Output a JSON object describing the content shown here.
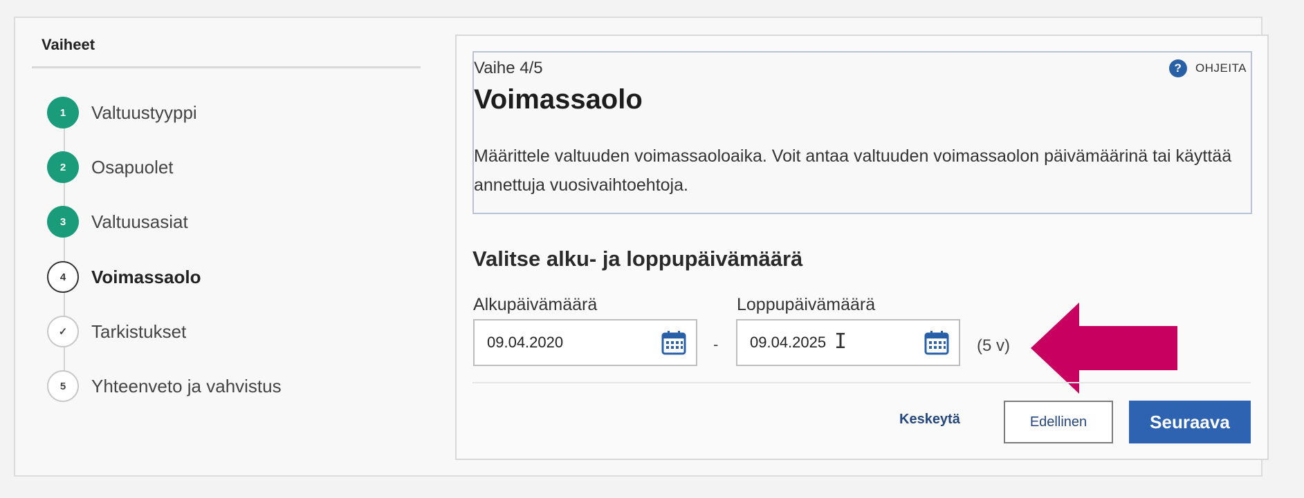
{
  "sidebar": {
    "title": "Vaiheet",
    "steps": [
      {
        "number": "1",
        "label": "Valtuustyyppi",
        "state": "done"
      },
      {
        "number": "2",
        "label": "Osapuolet",
        "state": "done"
      },
      {
        "number": "3",
        "label": "Valtuusasiat",
        "state": "done"
      },
      {
        "number": "4",
        "label": "Voimassaolo",
        "state": "current"
      },
      {
        "number": "✓",
        "label": "Tarkistukset",
        "state": "todo"
      },
      {
        "number": "5",
        "label": "Yhteenveto ja vahvistus",
        "state": "todo"
      }
    ]
  },
  "header": {
    "step_counter": "Vaihe 4/5",
    "help_label": "OHJEITA",
    "help_icon": "?",
    "title": "Voimassaolo",
    "description": "Määrittele valtuuden voimassaoloaika. Voit antaa valtuuden voimassaolon päivämäärinä tai käyttää annettuja vuosivaihtoehtoja."
  },
  "dates": {
    "section_title": "Valitse alku- ja loppupäivämäärä",
    "start_label": "Alkupäivämäärä",
    "start_value": "09.04.2020",
    "separator": "-",
    "end_label": "Loppupäivämäärä",
    "end_value": "09.04.2025",
    "duration": "(5 v)"
  },
  "actions": {
    "cancel_label": "Keskeytä",
    "previous_label": "Edellinen",
    "next_label": "Seuraava"
  },
  "colors": {
    "done_step": "#1a9c7a",
    "primary_button": "#2d63b1",
    "arrow": "#c8005f",
    "link": "#24467c"
  },
  "icons": {
    "help": "question-circle-icon",
    "calendar": "calendar-icon",
    "annotation": "arrow-left-icon",
    "cursor": "text-cursor-icon"
  }
}
